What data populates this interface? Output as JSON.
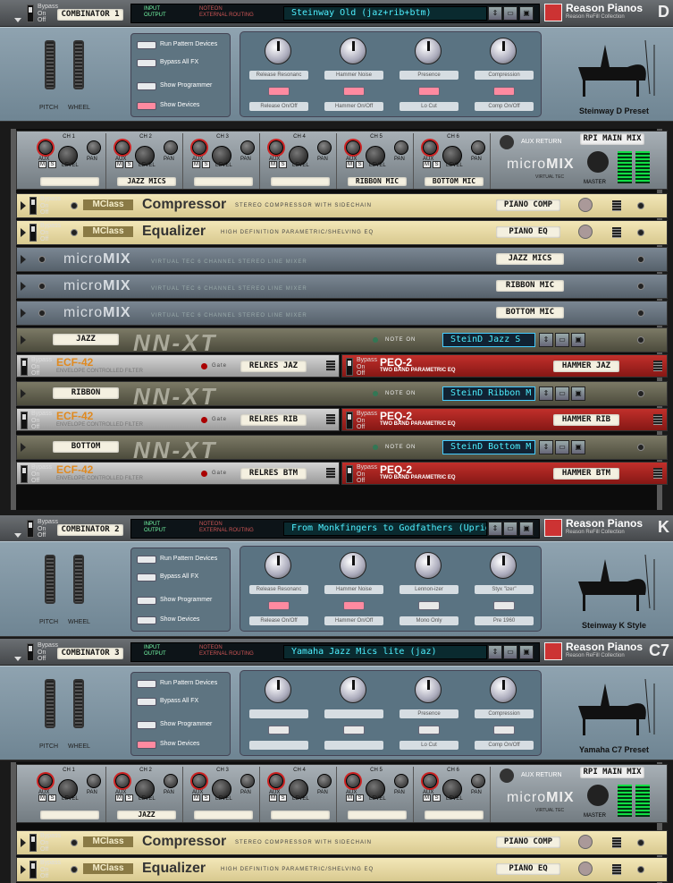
{
  "combinators": [
    {
      "name": "COMBINATOR 1",
      "patch": "Steinway Old (jaz+rib+btm)",
      "io": {
        "input": "INPUT",
        "output": "OUTPUT",
        "noteon": "NOTEON",
        "ext": "EXTERNAL ROUTING"
      },
      "bypass": [
        "Bypass",
        "On",
        "Off"
      ],
      "buttons": [
        "Run Pattern Devices",
        "Bypass All FX",
        "Show Programmer",
        "Show Devices"
      ],
      "knobs": [
        "Release Resonanc",
        "Hammer Noise",
        "Presence",
        "Compression"
      ],
      "kbuttons": [
        "Release On/Off",
        "Hammer On/Off",
        "Lo Cut",
        "Comp On/Off"
      ],
      "wheels": [
        "PITCH",
        "WHEEL"
      ],
      "logo": {
        "name": "Reason Pianos",
        "sub": "Reason ReFill Collection",
        "letter": "D"
      },
      "preset": "Steinway D Preset"
    },
    {
      "name": "COMBINATOR 2",
      "patch": "From Monkfingers to Godfathers (Upright)",
      "buttons": [
        "Run Pattern Devices",
        "Bypass All FX",
        "Show Programmer",
        "Show Devices"
      ],
      "knobs": [
        "Release Resonanc",
        "Hammer Noise",
        "Lennon-izer",
        "Styx \"izer\""
      ],
      "kbuttons": [
        "Release On/Off",
        "Hammer On/Off",
        "Mono Only",
        "Pre 1960"
      ],
      "wheels": [
        "PITCH",
        "WHEEL"
      ],
      "logo": {
        "name": "Reason Pianos",
        "sub": "Reason ReFill Collection",
        "letter": "K"
      },
      "preset": "Steinway K Style"
    },
    {
      "name": "COMBINATOR 3",
      "patch": "Yamaha Jazz Mics lite (jaz)",
      "buttons": [
        "Run Pattern Devices",
        "Bypass All FX",
        "Show Programmer",
        "Show Devices"
      ],
      "knobs": [
        "",
        "",
        "Presence",
        "Compression"
      ],
      "kbuttons": [
        "",
        "",
        "Lo Cut",
        "Comp On/Off"
      ],
      "wheels": [
        "PITCH",
        "WHEEL"
      ],
      "logo": {
        "name": "Reason Pianos",
        "sub": "Reason ReFill Collection",
        "letter": "C7"
      },
      "preset": "Yamaha C7 Preset"
    }
  ],
  "mixer1": {
    "channels": [
      {
        "ch": "CH 1",
        "tape": ""
      },
      {
        "ch": "CH 2",
        "tape": "JAZZ MICS"
      },
      {
        "ch": "CH 3",
        "tape": ""
      },
      {
        "ch": "CH 4",
        "tape": ""
      },
      {
        "ch": "CH 5",
        "tape": "RIBBON MIC"
      },
      {
        "ch": "CH 6",
        "tape": "BOTTOM MIC"
      }
    ],
    "labels": {
      "aux": "AUX",
      "level": "LEVEL",
      "pan": "PAN",
      "m": "M",
      "s": "S",
      "auxreturn": "AUX RETURN",
      "master": "MASTER",
      "brand": "micro",
      "brand2": "MIX",
      "vt": "VIRTUAL TEC"
    },
    "name": "RPI MAIN MIX"
  },
  "mixer2": {
    "channels": [
      {
        "ch": "CH 1",
        "tape": ""
      },
      {
        "ch": "CH 2",
        "tape": "JAZZ"
      },
      {
        "ch": "CH 3",
        "tape": ""
      },
      {
        "ch": "CH 4",
        "tape": ""
      },
      {
        "ch": "CH 5",
        "tape": ""
      },
      {
        "ch": "CH 6",
        "tape": ""
      }
    ],
    "name": "RPI MAIN MIX"
  },
  "devices1": [
    {
      "type": "mclass",
      "title": "Compressor",
      "sub": "STEREO COMPRESSOR WITH SIDECHAIN",
      "tape": "PIANO COMP",
      "brand": "MClass"
    },
    {
      "type": "mclass",
      "title": "Equalizer",
      "sub": "HIGH DEFINITION PARAMETRIC/SHELVING EQ",
      "tape": "PIANO EQ",
      "brand": "MClass"
    },
    {
      "type": "mmix",
      "sub": "VIRTUAL TEC 6 CHANNEL STEREO LINE MIXER",
      "tape": "JAZZ MICS"
    },
    {
      "type": "mmix",
      "sub": "VIRTUAL TEC 6 CHANNEL STEREO LINE MIXER",
      "tape": "RIBBON MIC"
    },
    {
      "type": "mmix",
      "sub": "VIRTUAL TEC 6 CHANNEL STEREO LINE MIXER",
      "tape": "BOTTOM MIC"
    }
  ],
  "chains": [
    {
      "nn": "JAZZ",
      "patch": "SteinD Jazz S",
      "ecf": "RELRES JAZ",
      "peq": "HAMMER JAZ"
    },
    {
      "nn": "RIBBON",
      "patch": "SteinD Ribbon M",
      "ecf": "RELRES RIB",
      "peq": "HAMMER RIB"
    },
    {
      "nn": "BOTTOM",
      "patch": "SteinD Bottom M",
      "ecf": "RELRES BTM",
      "peq": "HAMMER BTM"
    }
  ],
  "nnxt": {
    "logo": "NN-XT",
    "noteon": "NOTE ON"
  },
  "ecf": {
    "name": "ECF-42",
    "desc": "ENVELOPE CONTROLLED FILTER",
    "gate": "Gate"
  },
  "peq": {
    "name": "PEQ-2",
    "desc": "TWO BAND PARAMETRIC EQ"
  },
  "devices3": [
    {
      "title": "Compressor",
      "sub": "STEREO COMPRESSOR WITH SIDECHAIN",
      "tape": "PIANO COMP",
      "brand": "MClass"
    },
    {
      "title": "Equalizer",
      "sub": "HIGH DEFINITION PARAMETRIC/SHELVING EQ",
      "tape": "PIANO EQ",
      "brand": "MClass"
    }
  ]
}
